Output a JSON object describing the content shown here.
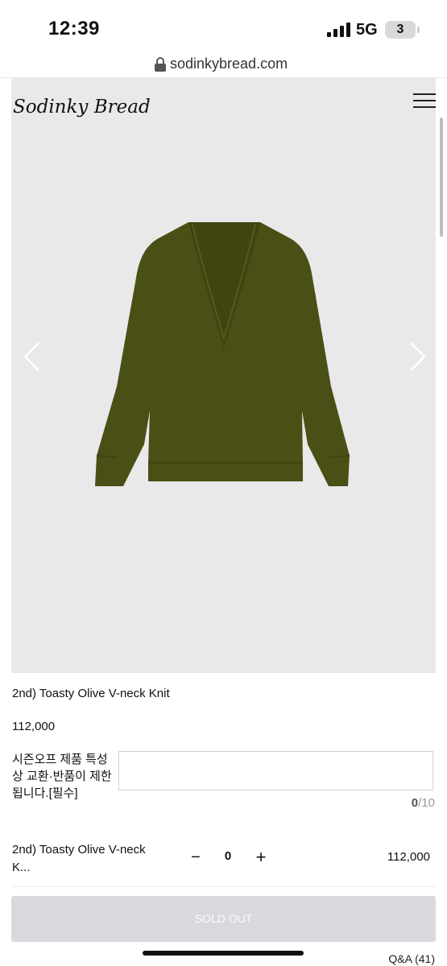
{
  "status_bar": {
    "time": "12:39",
    "network": "5G",
    "battery": "3"
  },
  "browser": {
    "url": "sodinkybread.com"
  },
  "header": {
    "logo_text": "Sodinky Bread"
  },
  "product": {
    "name": "2nd) Toasty Olive V-neck Knit",
    "price": "112,000",
    "image_color": "#4a4f16"
  },
  "option": {
    "label": "시즌오프 제품 특성상 교환·반품이 제한됩니다.[필수]",
    "input_value": "",
    "char_current": "0",
    "char_max": "/10"
  },
  "selected_item": {
    "name": "2nd) Toasty Olive V-neck K...",
    "minus": "−",
    "quantity": "0",
    "plus": "+",
    "price": "112,000"
  },
  "buttons": {
    "sold_out": "SOLD OUT"
  },
  "footer": {
    "qa_link": "Q&A (41)"
  }
}
